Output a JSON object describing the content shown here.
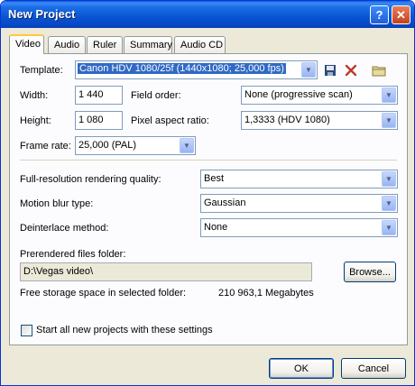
{
  "window": {
    "title": "New Project"
  },
  "tabs": [
    "Video",
    "Audio",
    "Ruler",
    "Summary",
    "Audio CD"
  ],
  "template": {
    "label": "Template:",
    "value": "Canon HDV 1080/25f (1440x1080; 25,000 fps)"
  },
  "width": {
    "label": "Width:",
    "value": "1 440"
  },
  "height": {
    "label": "Height:",
    "value": "1 080"
  },
  "field_order": {
    "label": "Field order:",
    "value": "None (progressive scan)"
  },
  "pixel_aspect": {
    "label": "Pixel aspect ratio:",
    "value": "1,3333 (HDV 1080)"
  },
  "frame_rate": {
    "label": "Frame rate:",
    "value": "25,000 (PAL)"
  },
  "render_quality": {
    "label": "Full-resolution rendering quality:",
    "value": "Best"
  },
  "motion_blur": {
    "label": "Motion blur type:",
    "value": "Gaussian"
  },
  "deinterlace": {
    "label": "Deinterlace method:",
    "value": "None"
  },
  "prerendered": {
    "label": "Prerendered files folder:",
    "value": "D:\\Vegas video\\",
    "browse": "Browse..."
  },
  "storage": {
    "label": "Free storage space in selected folder:",
    "value": "210 963,1 Megabytes"
  },
  "start_all": {
    "label": "Start all new projects with these settings",
    "checked": false
  },
  "buttons": {
    "ok": "OK",
    "cancel": "Cancel"
  },
  "icons": {
    "help": "?",
    "close": "✕"
  }
}
